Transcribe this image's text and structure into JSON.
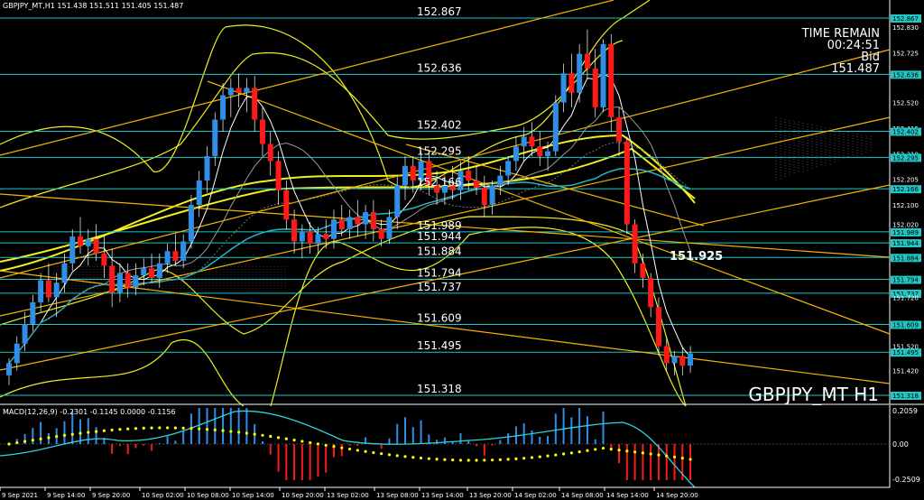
{
  "window": {
    "header": "GBPJPY_MT,H1  151.438 151.511 151.405 151.487",
    "watermark": "GBPJPY_MT H1"
  },
  "info_panel": {
    "time_remain_label": "TIME REMAIN",
    "time_remain": "00:24:51",
    "bid_label": "Bid",
    "bid": "151.487"
  },
  "level_labels": [
    "152.867",
    "152.636",
    "152.402",
    "152.295",
    "152.166",
    "151.989",
    "151.944",
    "151.884",
    "151.794",
    "151.737",
    "151.609",
    "151.495",
    "151.318"
  ],
  "highlight_level": "151.925",
  "price_scale": [
    {
      "v": "152.867",
      "box": true
    },
    {
      "v": "152.830",
      "box": false
    },
    {
      "v": "152.725",
      "box": false
    },
    {
      "v": "152.636",
      "box": true
    },
    {
      "v": "152.520",
      "box": false
    },
    {
      "v": "152.415",
      "box": false
    },
    {
      "v": "152.402",
      "box": true
    },
    {
      "v": "152.310",
      "box": false
    },
    {
      "v": "152.295",
      "box": true
    },
    {
      "v": "152.205",
      "box": false
    },
    {
      "v": "152.166",
      "box": true
    },
    {
      "v": "152.100",
      "box": false
    },
    {
      "v": "152.020",
      "box": false
    },
    {
      "v": "151.989",
      "box": true
    },
    {
      "v": "151.944",
      "box": true
    },
    {
      "v": "151.884",
      "box": true
    },
    {
      "v": "151.794",
      "box": true
    },
    {
      "v": "151.737",
      "box": true
    },
    {
      "v": "151.720",
      "box": false
    },
    {
      "v": "151.609",
      "box": true
    },
    {
      "v": "151.520",
      "box": false
    },
    {
      "v": "151.495",
      "box": true
    },
    {
      "v": "151.420",
      "box": false
    },
    {
      "v": "151.318",
      "box": true
    }
  ],
  "macd": {
    "label": "MACD(12,26,9) -0.2301 -0.1145 0.0000 -0.1156",
    "scale_top": "0.2059",
    "scale_zero": "0.00",
    "scale_bottom": "-0.2509"
  },
  "time_axis": [
    "9 Sep 2021",
    "9 Sep 14:00",
    "9 Sep 20:00",
    "10 Sep 02:00",
    "10 Sep 08:00",
    "10 Sep 14:00",
    "10 Sep 20:00",
    "13 Sep 02:00",
    "13 Sep 08:00",
    "13 Sep 14:00",
    "13 Sep 20:00",
    "14 Sep 02:00",
    "14 Sep 08:00",
    "14 Sep 14:00",
    "14 Sep 20:00"
  ],
  "colors": {
    "bull": "#2f8fe8",
    "bear": "#ff1a1a",
    "level_line": "#21c6c6",
    "trend_line": "#f2b400",
    "band": "#f0f020",
    "macd_signal": "#ffff00",
    "macd_line": "#2ad3e0"
  },
  "candles": [
    [
      151.4,
      151.47,
      151.36,
      151.45
    ],
    [
      151.45,
      151.56,
      151.42,
      151.53
    ],
    [
      151.53,
      151.66,
      151.5,
      151.61
    ],
    [
      151.61,
      151.73,
      151.58,
      151.7
    ],
    [
      151.7,
      151.82,
      151.66,
      151.79
    ],
    [
      151.79,
      151.86,
      151.7,
      151.72
    ],
    [
      151.72,
      151.82,
      151.64,
      151.78
    ],
    [
      151.78,
      151.9,
      151.74,
      151.86
    ],
    [
      151.86,
      152.0,
      151.83,
      151.97
    ],
    [
      151.97,
      152.05,
      151.9,
      151.93
    ],
    [
      151.93,
      152.0,
      151.85,
      151.96
    ],
    [
      151.96,
      152.02,
      151.87,
      151.9
    ],
    [
      151.9,
      151.97,
      151.8,
      151.85
    ],
    [
      151.85,
      151.92,
      151.68,
      151.74
    ],
    [
      151.74,
      151.86,
      151.7,
      151.82
    ],
    [
      151.82,
      151.86,
      151.72,
      151.76
    ],
    [
      151.76,
      151.86,
      151.73,
      151.81
    ],
    [
      151.81,
      151.88,
      151.77,
      151.84
    ],
    [
      151.84,
      151.9,
      151.78,
      151.8
    ],
    [
      151.8,
      151.9,
      151.76,
      151.86
    ],
    [
      151.86,
      151.94,
      151.82,
      151.91
    ],
    [
      151.91,
      151.98,
      151.85,
      151.87
    ],
    [
      151.87,
      151.98,
      151.84,
      151.95
    ],
    [
      151.95,
      152.14,
      151.92,
      152.1
    ],
    [
      152.1,
      152.24,
      152.05,
      152.2
    ],
    [
      152.2,
      152.34,
      152.15,
      152.3
    ],
    [
      152.3,
      152.48,
      152.26,
      152.45
    ],
    [
      152.45,
      152.6,
      152.4,
      152.55
    ],
    [
      152.55,
      152.62,
      152.46,
      152.58
    ],
    [
      152.58,
      152.64,
      152.5,
      152.56
    ],
    [
      152.56,
      152.62,
      152.48,
      152.58
    ],
    [
      152.58,
      152.63,
      152.4,
      152.45
    ],
    [
      152.45,
      152.5,
      152.3,
      152.35
    ],
    [
      152.35,
      152.4,
      152.22,
      152.28
    ],
    [
      152.28,
      152.32,
      152.1,
      152.16
    ],
    [
      152.16,
      152.2,
      152.0,
      152.04
    ],
    [
      152.04,
      152.08,
      151.9,
      151.95
    ],
    [
      151.95,
      152.02,
      151.88,
      151.99
    ],
    [
      151.99,
      152.03,
      151.9,
      151.94
    ],
    [
      151.94,
      152.01,
      151.9,
      151.98
    ],
    [
      151.98,
      152.04,
      151.92,
      151.96
    ],
    [
      151.96,
      152.08,
      151.92,
      152.04
    ],
    [
      152.04,
      152.1,
      151.97,
      152.0
    ],
    [
      152.0,
      152.08,
      151.96,
      152.05
    ],
    [
      152.05,
      152.12,
      151.97,
      152.02
    ],
    [
      152.02,
      152.1,
      151.96,
      152.07
    ],
    [
      152.07,
      152.12,
      151.95,
      152.0
    ],
    [
      152.0,
      152.04,
      151.93,
      151.96
    ],
    [
      151.96,
      152.08,
      151.94,
      152.05
    ],
    [
      152.05,
      152.22,
      152.0,
      152.18
    ],
    [
      152.18,
      152.3,
      152.12,
      152.26
    ],
    [
      152.26,
      152.3,
      152.15,
      152.2
    ],
    [
      152.2,
      152.32,
      152.16,
      152.28
    ],
    [
      152.28,
      152.32,
      152.14,
      152.18
    ],
    [
      152.18,
      152.24,
      152.1,
      152.15
    ],
    [
      152.15,
      152.22,
      152.1,
      152.18
    ],
    [
      152.18,
      152.26,
      152.12,
      152.16
    ],
    [
      152.16,
      152.28,
      152.12,
      152.24
    ],
    [
      152.24,
      152.3,
      152.16,
      152.2
    ],
    [
      152.2,
      152.26,
      152.14,
      152.17
    ],
    [
      152.17,
      152.22,
      152.05,
      152.1
    ],
    [
      152.1,
      152.2,
      152.06,
      152.18
    ],
    [
      152.18,
      152.26,
      152.14,
      152.22
    ],
    [
      152.22,
      152.3,
      152.18,
      152.28
    ],
    [
      152.28,
      152.38,
      152.24,
      152.34
    ],
    [
      152.34,
      152.42,
      152.28,
      152.38
    ],
    [
      152.38,
      152.44,
      152.3,
      152.34
    ],
    [
      152.34,
      152.4,
      152.26,
      152.3
    ],
    [
      152.3,
      152.36,
      152.24,
      152.32
    ],
    [
      152.32,
      152.55,
      152.3,
      152.52
    ],
    [
      152.52,
      152.68,
      152.48,
      152.64
    ],
    [
      152.64,
      152.72,
      152.5,
      152.56
    ],
    [
      152.56,
      152.76,
      152.52,
      152.72
    ],
    [
      152.72,
      152.82,
      152.62,
      152.66
    ],
    [
      152.66,
      152.74,
      152.46,
      152.5
    ],
    [
      152.5,
      152.78,
      152.48,
      152.76
    ],
    [
      152.76,
      152.8,
      152.4,
      152.46
    ],
    [
      152.46,
      152.5,
      152.3,
      152.36
    ],
    [
      152.36,
      152.38,
      151.98,
      152.02
    ],
    [
      152.02,
      152.04,
      151.82,
      151.86
    ],
    [
      151.86,
      151.9,
      151.76,
      151.8
    ],
    [
      151.8,
      151.82,
      151.64,
      151.68
    ],
    [
      151.68,
      151.72,
      151.48,
      151.52
    ],
    [
      151.52,
      151.56,
      151.42,
      151.45
    ],
    [
      151.45,
      151.5,
      151.4,
      151.48
    ],
    [
      151.48,
      151.52,
      151.4,
      151.44
    ],
    [
      151.44,
      151.52,
      151.41,
      151.49
    ]
  ]
}
